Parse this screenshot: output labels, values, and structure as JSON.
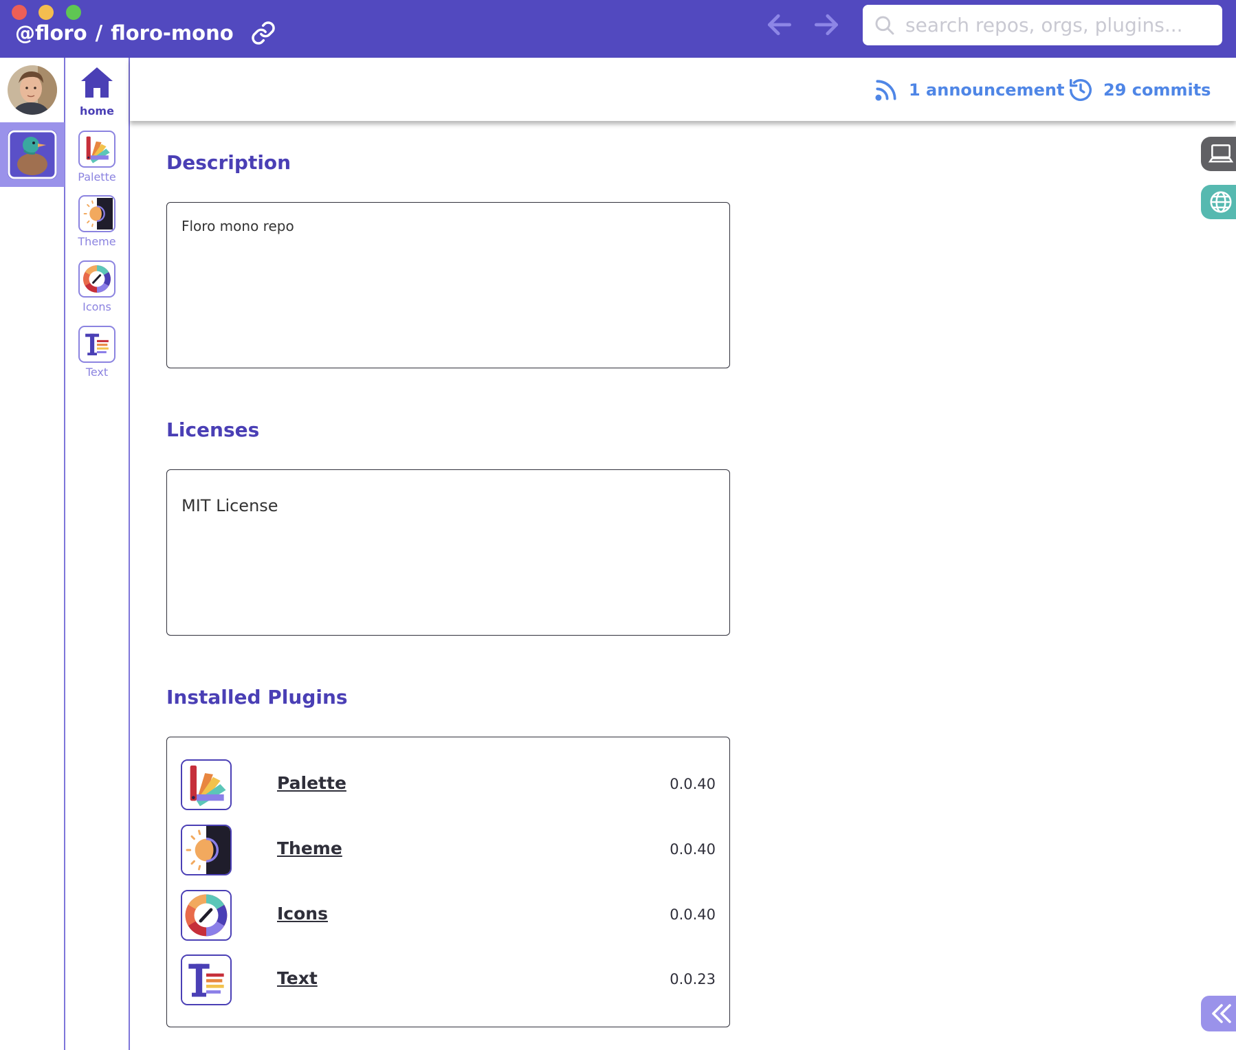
{
  "window": {
    "owner": "@floro",
    "separator": "/",
    "repo": "floro-mono"
  },
  "titlebar": {
    "link_icon": "link-icon",
    "back_icon": "arrow-left-icon",
    "forward_icon": "arrow-right-icon"
  },
  "search": {
    "placeholder": "search repos, orgs, plugins...",
    "value": "",
    "icon": "search-icon"
  },
  "sidebar": {
    "items": [
      {
        "label": "home",
        "icon": "home-icon"
      },
      {
        "label": "Palette",
        "icon": "palette-plugin-icon"
      },
      {
        "label": "Theme",
        "icon": "theme-plugin-icon"
      },
      {
        "label": "Icons",
        "icon": "icons-plugin-icon"
      },
      {
        "label": "Text",
        "icon": "text-plugin-icon"
      }
    ]
  },
  "infobar": {
    "announcements": "1 announcement",
    "commits": "29 commits"
  },
  "description": {
    "title": "Description",
    "text": "Floro mono repo"
  },
  "licenses": {
    "title": "Licenses",
    "text": "MIT License"
  },
  "plugins": {
    "title": "Installed Plugins",
    "items": [
      {
        "name": "Palette",
        "version": "0.0.40",
        "icon": "palette-plugin-icon"
      },
      {
        "name": "Theme",
        "version": "0.0.40",
        "icon": "theme-plugin-icon"
      },
      {
        "name": "Icons",
        "version": "0.0.40",
        "icon": "icons-plugin-icon"
      },
      {
        "name": "Text",
        "version": "0.0.23",
        "icon": "text-plugin-icon"
      }
    ]
  },
  "colors": {
    "titlebar": "#5249bf",
    "accent": "#4a3fb5",
    "link_blue": "#4f86e6",
    "sidebar_border": "#7d75d9",
    "selected_tile_bg": "#9a92ea"
  }
}
